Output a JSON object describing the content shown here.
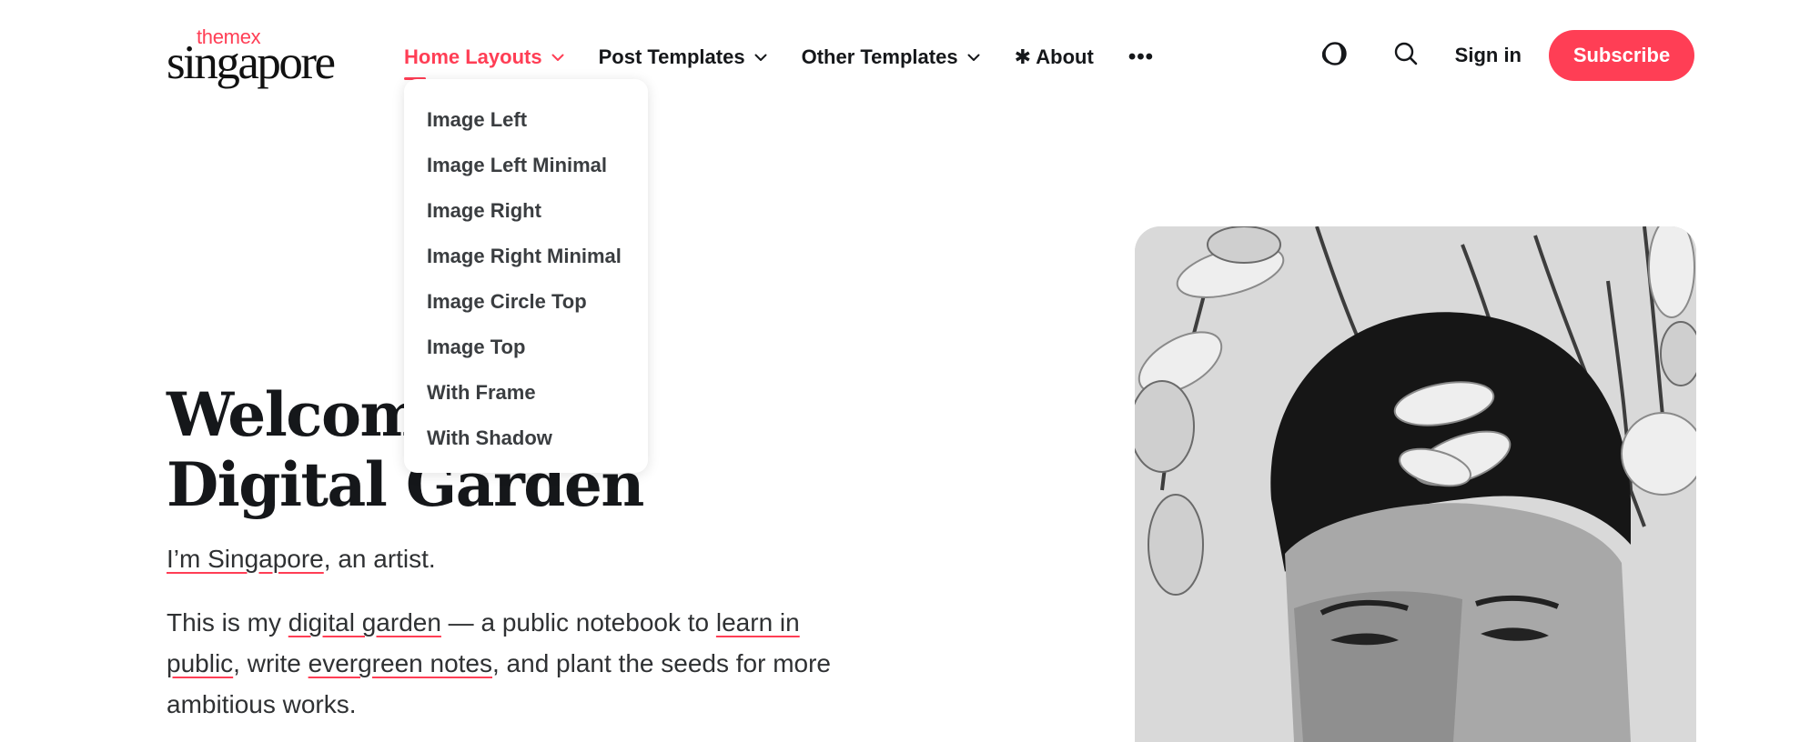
{
  "brand": {
    "logo_top": "themex",
    "logo_main": "singapore",
    "accent_color": "#ff3e55"
  },
  "nav": {
    "items": [
      {
        "label": "Home Layouts",
        "active": true,
        "has_dropdown": true
      },
      {
        "label": "Post Templates",
        "has_dropdown": true
      },
      {
        "label": "Other Templates",
        "has_dropdown": true
      },
      {
        "label": "✱ About"
      }
    ],
    "more_label": "•••",
    "dropdown": [
      "Image Left",
      "Image Left Minimal",
      "Image Right",
      "Image Right Minimal",
      "Image Circle Top",
      "Image Top",
      "With Frame",
      "With Shadow"
    ]
  },
  "header": {
    "theme_icon": "half-moon-icon",
    "search_icon": "search-icon",
    "signin_label": "Sign in",
    "subscribe_label": "Subscribe"
  },
  "hero": {
    "title_line1": "Welcome",
    "title_line2": "Digital Garden",
    "intro_link": "I’m Singapore",
    "intro_rest": ", an artist.",
    "body_1": "This is my ",
    "link_digital_garden": "digital garden",
    "body_2": " — a public notebook to ",
    "link_learn_public": "learn in public",
    "body_3": ", write ",
    "link_evergreen": "evergreen notes",
    "body_4": ", and plant the seeds for more ambitious works."
  }
}
